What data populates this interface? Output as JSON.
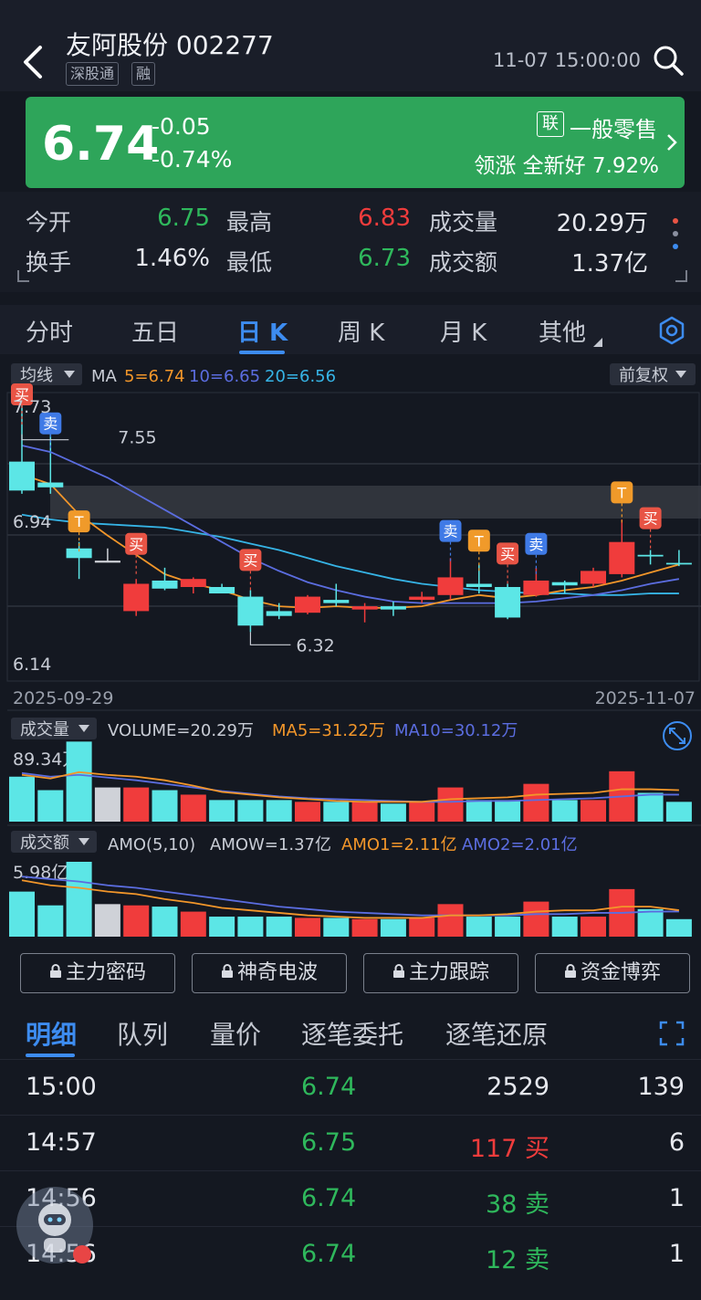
{
  "header": {
    "title": "友阿股份 002277",
    "tags": [
      "深股通",
      "融"
    ],
    "timestamp": "11-07 15:00:00"
  },
  "quote": {
    "price": "6.74",
    "change": "-0.05",
    "change_pct": "-0.74%",
    "sector_badge": "联",
    "sector": "一般零售",
    "leader": "领涨 全新好 7.92%"
  },
  "stats": {
    "open_label": "今开",
    "open": "6.75",
    "high_label": "最高",
    "high": "6.83",
    "volume_label": "成交量",
    "volume": "20.29万",
    "turnover_label": "换手",
    "turnover": "1.46%",
    "low_label": "最低",
    "low": "6.73",
    "amount_label": "成交额",
    "amount": "1.37亿"
  },
  "tabs": [
    "分时",
    "五日",
    "日 K",
    "周 K",
    "月 K",
    "其他"
  ],
  "active_tab": "日 K",
  "indicator": {
    "ma_btn": "均线",
    "ma": "MA",
    "ma5": "5=6.74",
    "ma10": "10=6.65",
    "ma20": "20=6.56",
    "adjust": "前复权"
  },
  "colors": {
    "up": "#f03c3c",
    "down": "#5ce6e6",
    "flat": "#cfd2d8",
    "ma5": "#f2962a",
    "ma10": "#5b6de0",
    "ma20": "#36b4e6",
    "accent": "#3d8cf0",
    "banner": "#2ea55a"
  },
  "chart_data": {
    "type": "candlestick",
    "x_start": "2025-09-29",
    "x_end": "2025-11-07",
    "y_labels": [
      "7.73",
      "6.94",
      "6.14"
    ],
    "y_range": [
      6.14,
      7.73
    ],
    "price_high_label": "7.55",
    "price_low_label": "6.32",
    "candles": [
      {
        "o": 7.38,
        "c": 7.2,
        "h": 7.73,
        "l": 7.18
      },
      {
        "o": 7.25,
        "c": 7.22,
        "h": 7.55,
        "l": 7.18
      },
      {
        "o": 6.84,
        "c": 6.78,
        "h": 6.88,
        "l": 6.65
      },
      {
        "o": 6.76,
        "c": 6.76,
        "h": 6.84,
        "l": 6.76
      },
      {
        "o": 6.45,
        "c": 6.62,
        "h": 6.65,
        "l": 6.42
      },
      {
        "o": 6.64,
        "c": 6.59,
        "h": 6.72,
        "l": 6.58
      },
      {
        "o": 6.6,
        "c": 6.65,
        "h": 6.66,
        "l": 6.56
      },
      {
        "o": 6.6,
        "c": 6.56,
        "h": 6.62,
        "l": 6.58
      },
      {
        "o": 6.54,
        "c": 6.36,
        "h": 6.58,
        "l": 6.32
      },
      {
        "o": 6.45,
        "c": 6.42,
        "h": 6.5,
        "l": 6.4
      },
      {
        "o": 6.44,
        "c": 6.54,
        "h": 6.55,
        "l": 6.43
      },
      {
        "o": 6.52,
        "c": 6.5,
        "h": 6.62,
        "l": 6.48
      },
      {
        "o": 6.46,
        "c": 6.48,
        "h": 6.5,
        "l": 6.38
      },
      {
        "o": 6.48,
        "c": 6.46,
        "h": 6.51,
        "l": 6.42
      },
      {
        "o": 6.52,
        "c": 6.54,
        "h": 6.57,
        "l": 6.5
      },
      {
        "o": 6.55,
        "c": 6.66,
        "h": 6.78,
        "l": 6.52
      },
      {
        "o": 6.62,
        "c": 6.6,
        "h": 6.74,
        "l": 6.56
      },
      {
        "o": 6.6,
        "c": 6.41,
        "h": 6.62,
        "l": 6.4
      },
      {
        "o": 6.55,
        "c": 6.64,
        "h": 6.72,
        "l": 6.54
      },
      {
        "o": 6.63,
        "c": 6.61,
        "h": 6.64,
        "l": 6.56
      },
      {
        "o": 6.62,
        "c": 6.7,
        "h": 6.72,
        "l": 6.6
      },
      {
        "o": 6.68,
        "c": 6.88,
        "h": 7.02,
        "l": 6.66
      },
      {
        "o": 6.8,
        "c": 6.79,
        "h": 6.83,
        "l": 6.74
      },
      {
        "o": 6.75,
        "c": 6.74,
        "h": 6.83,
        "l": 6.73
      }
    ],
    "signals": [
      {
        "i": 0,
        "text": "买",
        "color": "#e85445",
        "y": 7.73
      },
      {
        "i": 1,
        "text": "卖",
        "color": "#3f7ae6",
        "y": 7.55
      },
      {
        "i": 2,
        "text": "T",
        "color": "#f09a2a",
        "y": 6.94
      },
      {
        "i": 4,
        "text": "买",
        "color": "#e85445",
        "y": 6.8
      },
      {
        "i": 8,
        "text": "买",
        "color": "#e85445",
        "y": 6.7
      },
      {
        "i": 15,
        "text": "卖",
        "color": "#3f7ae6",
        "y": 6.88
      },
      {
        "i": 16,
        "text": "T",
        "color": "#f09a2a",
        "y": 6.82
      },
      {
        "i": 17,
        "text": "买",
        "color": "#e85445",
        "y": 6.74
      },
      {
        "i": 18,
        "text": "卖",
        "color": "#3f7ae6",
        "y": 6.8
      },
      {
        "i": 21,
        "text": "T",
        "color": "#f09a2a",
        "y": 7.12
      },
      {
        "i": 22,
        "text": "买",
        "color": "#e85445",
        "y": 6.96
      }
    ],
    "ma5": [
      7.3,
      7.24,
      7.05,
      6.92,
      6.8,
      6.68,
      6.62,
      6.58,
      6.52,
      6.48,
      6.47,
      6.48,
      6.47,
      6.47,
      6.48,
      6.52,
      6.55,
      6.53,
      6.55,
      6.58,
      6.6,
      6.64,
      6.69,
      6.74
    ],
    "ma10": [
      7.48,
      7.44,
      7.36,
      7.28,
      7.18,
      7.08,
      6.98,
      6.88,
      6.78,
      6.7,
      6.63,
      6.58,
      6.54,
      6.51,
      6.5,
      6.5,
      6.5,
      6.5,
      6.51,
      6.53,
      6.55,
      6.58,
      6.62,
      6.65
    ],
    "ma20": [
      7.05,
      7.02,
      7.0,
      6.99,
      6.98,
      6.97,
      6.94,
      6.91,
      6.87,
      6.83,
      6.78,
      6.73,
      6.69,
      6.65,
      6.62,
      6.6,
      6.58,
      6.57,
      6.56,
      6.56,
      6.55,
      6.55,
      6.56,
      6.56
    ],
    "volume": {
      "label": "VOLUME=20.29万",
      "ma5_label": "MA5=31.22万",
      "ma10_label": "MA10=30.12万",
      "max_label": "89.34万",
      "max": 89.34,
      "values": [
        50,
        35,
        89,
        38,
        38,
        35,
        30,
        24,
        24,
        24,
        22,
        22,
        22,
        20,
        22,
        38,
        24,
        24,
        42,
        24,
        24,
        56,
        32,
        22
      ],
      "ma5": [
        52,
        48,
        55,
        52,
        50,
        46,
        40,
        33,
        30,
        27,
        25,
        23,
        22,
        22,
        22,
        25,
        26,
        27,
        30,
        31,
        32,
        36,
        36,
        35
      ],
      "ma10": [
        54,
        50,
        52,
        49,
        46,
        42,
        38,
        34,
        31,
        28,
        26,
        25,
        24,
        23,
        22,
        22,
        23,
        23,
        24,
        25,
        26,
        28,
        30,
        30
      ]
    },
    "amount": {
      "label": "AMO(5,10)",
      "amow": "AMOW=1.37亿",
      "amo1": "AMO1=2.11亿",
      "amo2": "AMO2=2.01亿",
      "max_label": "5.98亿",
      "max": 5.98,
      "values": [
        3.6,
        2.5,
        5.98,
        2.6,
        2.5,
        2.4,
        2.0,
        1.6,
        1.6,
        1.6,
        1.5,
        1.5,
        1.4,
        1.4,
        1.5,
        2.6,
        1.6,
        1.6,
        2.8,
        1.6,
        1.6,
        3.8,
        2.2,
        1.4
      ],
      "ma5": [
        4.5,
        4.1,
        3.9,
        3.6,
        3.4,
        3.0,
        2.7,
        2.3,
        2.1,
        1.9,
        1.7,
        1.6,
        1.5,
        1.5,
        1.5,
        1.7,
        1.7,
        1.8,
        2.0,
        2.1,
        2.1,
        2.4,
        2.4,
        2.11
      ],
      "ma10": [
        4.8,
        4.6,
        4.4,
        4.1,
        3.9,
        3.6,
        3.3,
        3.0,
        2.7,
        2.4,
        2.2,
        2.0,
        1.9,
        1.8,
        1.7,
        1.7,
        1.7,
        1.7,
        1.8,
        1.8,
        1.9,
        1.9,
        2.0,
        2.01
      ]
    }
  },
  "sub_labels": {
    "volume_btn": "成交量",
    "amount_btn": "成交额"
  },
  "action_buttons": [
    "主力密码",
    "神奇电波",
    "主力跟踪",
    "资金博弈"
  ],
  "detail_tabs": [
    "明细",
    "队列",
    "量价",
    "逐笔委托",
    "逐笔还原"
  ],
  "trades": [
    {
      "time": "15:00",
      "price": "6.74",
      "vol": "2529",
      "side": "",
      "count": "139",
      "color": "#2fb85c",
      "side_color": "#e6e8ee"
    },
    {
      "time": "14:57",
      "price": "6.75",
      "vol": "117",
      "side": "买",
      "count": "6",
      "color": "#2fb85c",
      "side_color": "#f03c3c"
    },
    {
      "time": "14:56",
      "price": "6.74",
      "vol": "38",
      "side": "卖",
      "count": "1",
      "color": "#2fb85c",
      "side_color": "#2fb85c"
    },
    {
      "time": "14:56",
      "price": "6.74",
      "vol": "12",
      "side": "卖",
      "count": "1",
      "color": "#2fb85c",
      "side_color": "#2fb85c"
    }
  ]
}
